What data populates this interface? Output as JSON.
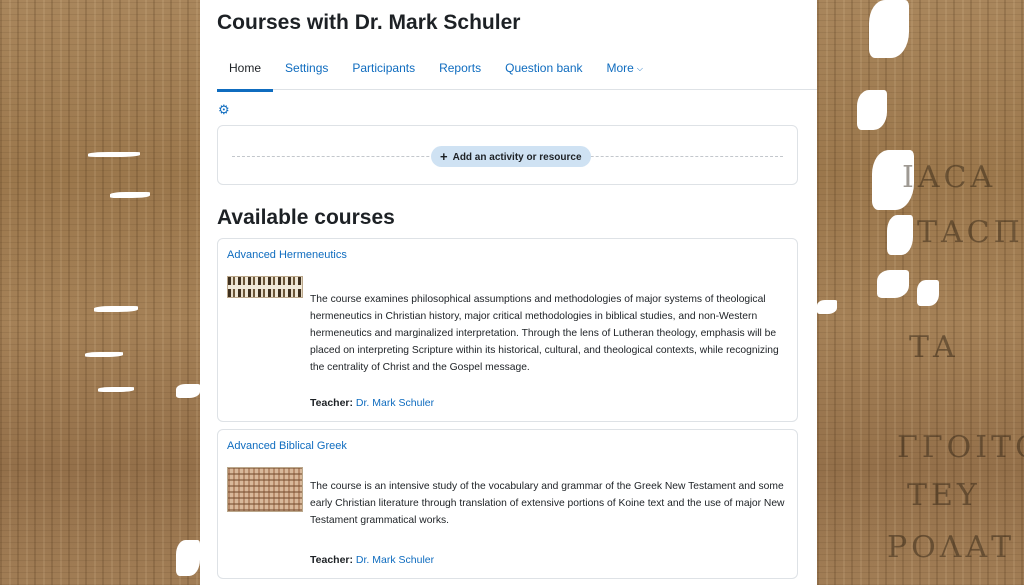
{
  "page": {
    "title": "Courses with Dr. Mark Schuler"
  },
  "tabs": [
    {
      "label": "Home",
      "active": true
    },
    {
      "label": "Settings",
      "active": false
    },
    {
      "label": "Participants",
      "active": false
    },
    {
      "label": "Reports",
      "active": false
    },
    {
      "label": "Question bank",
      "active": false
    },
    {
      "label": "More",
      "active": false
    }
  ],
  "settings_icon": "gear-icon",
  "add_activity": {
    "icon": "plus-icon",
    "label": "Add an activity or resource"
  },
  "available_courses": {
    "heading": "Available courses",
    "courses": [
      {
        "name": "Advanced Hermeneutics",
        "summary": "The course examines philosophical assumptions and methodologies of major systems of theological hermeneutics in Christian history, major critical methodologies in biblical studies, and non-Western hermeneutics and marginalized interpretation. Through the lens of Lutheran theology, emphasis will be placed on interpreting Scripture within its historical, cultural, and theological contexts, while recognizing the centrality of Christ and the Gospel message.",
        "teacher_label": "Teacher:",
        "teacher_name": "Dr. Mark Schuler"
      },
      {
        "name": "Advanced Biblical Greek",
        "summary": "The course is an intensive study of the vocabulary and grammar of the Greek New Testament and some early Christian literature through translation of extensive portions of Koine text and the use of major New Testament grammatical works.",
        "teacher_label": "Teacher:",
        "teacher_name": "Dr. Mark Schuler"
      }
    ]
  },
  "colors": {
    "link": "#0f6cbf",
    "text": "#1d2125",
    "add_button_bg": "#cfe2f3",
    "border": "#dee2e6"
  }
}
